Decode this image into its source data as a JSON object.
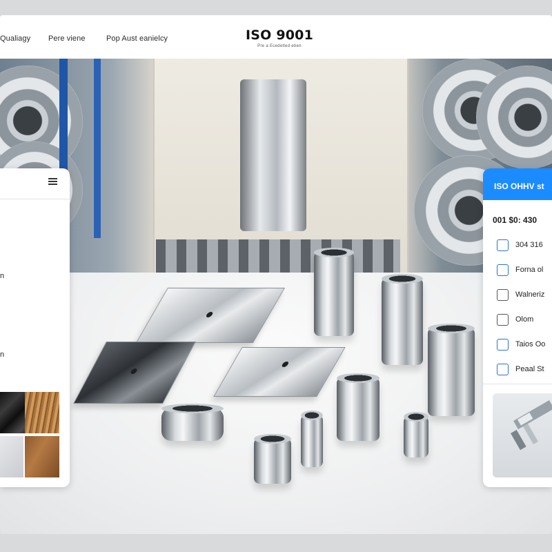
{
  "nav": {
    "links": [
      "Qualiagy",
      "Pere viene",
      "Pop Aust eanielcy"
    ],
    "brand_title": "ISO 9001",
    "brand_sub": "Pre a Ecedetled eben"
  },
  "left_panel": {
    "items": [
      "n",
      "n"
    ]
  },
  "right_panel": {
    "header": "ISO OHHV st",
    "code": "001 $0: 430",
    "options": [
      {
        "label": "304 316",
        "checked": false
      },
      {
        "label": "Forna ol",
        "checked": false
      },
      {
        "label": "Walneriz",
        "checked": false
      },
      {
        "label": "Olom",
        "checked": false
      },
      {
        "label": "Taios Oo",
        "checked": false
      },
      {
        "label": "Peaal St",
        "checked": false
      }
    ]
  },
  "colors": {
    "accent": "#1a8cff",
    "checkbox_border": "#2b73c9"
  }
}
